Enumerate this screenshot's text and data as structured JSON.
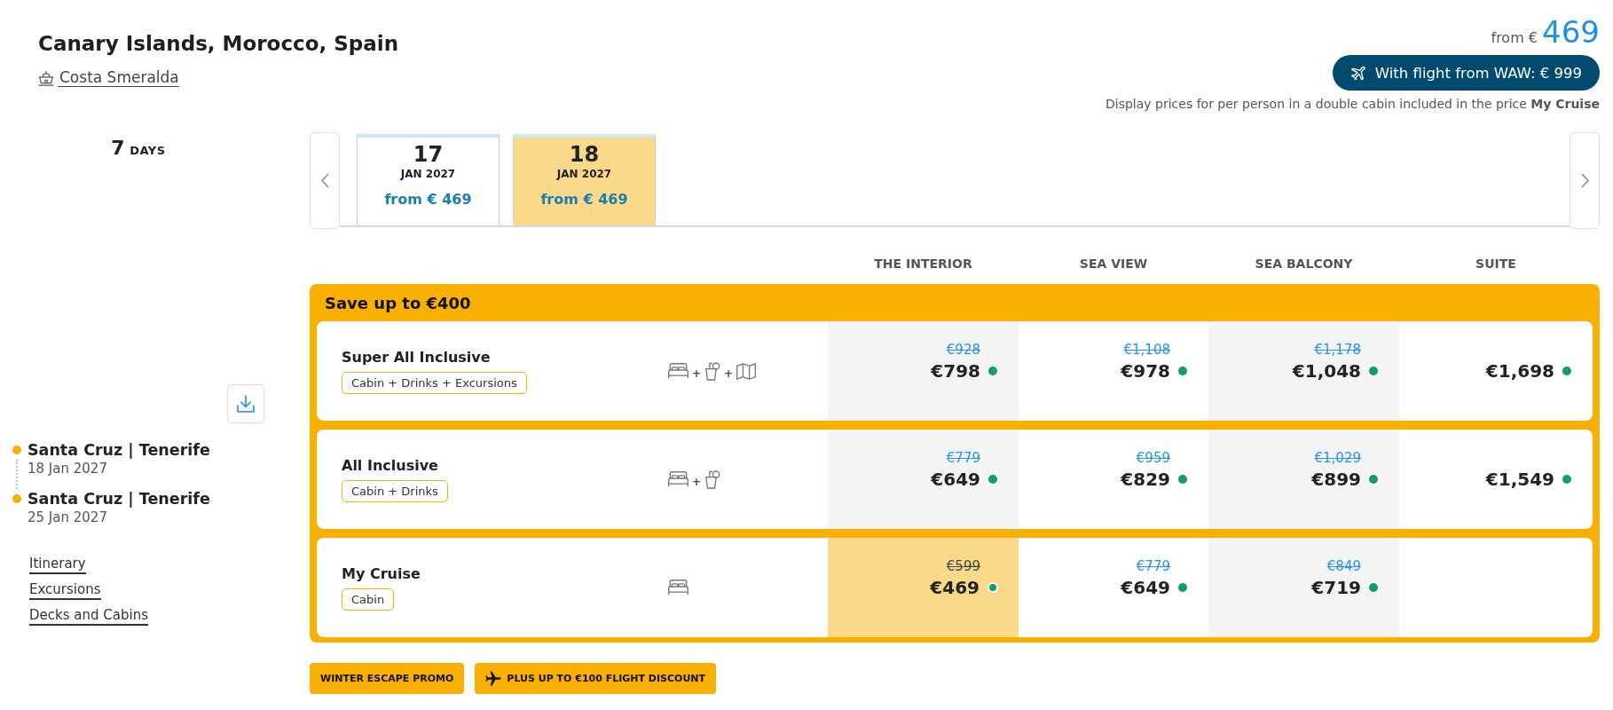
{
  "header": {
    "title": "Canary Islands, Morocco, Spain",
    "ship": "Costa Smeralda"
  },
  "pricing": {
    "from_label": "from €",
    "from_price": "469",
    "flight_button": "With flight from WAW: € 999",
    "note": "Display prices for per person in a double cabin included in the price **My Cruise**"
  },
  "duration": {
    "number": "7",
    "unit": "DAYS"
  },
  "date_tabs": [
    {
      "day": "17",
      "month": "JAN 2027",
      "price": "from € 469",
      "selected": false
    },
    {
      "day": "18",
      "month": "JAN 2027",
      "price": "from € 469",
      "selected": true
    }
  ],
  "route": [
    {
      "port": "Santa Cruz | Tenerife",
      "date": "18 Jan 2027"
    },
    {
      "port": "Santa Cruz | Tenerife",
      "date": "25 Jan 2027"
    }
  ],
  "links": [
    "Itinerary",
    "Excursions",
    "Decks and Cabins"
  ],
  "cabin_columns": [
    "THE INTERIOR",
    "SEA VIEW",
    "SEA BALCONY",
    "SUITE"
  ],
  "fare_group": {
    "banner": "Save up to €400",
    "fares": [
      {
        "name": "Super All Inclusive",
        "includes": "Cabin + Drinks + Excursions",
        "amenities": [
          {
            "kind": "cabin"
          },
          {
            "kind": "drinks",
            "joiner": "+"
          },
          {
            "kind": "excursions",
            "joiner": "+"
          }
        ],
        "prices": [
          {
            "was": "€928",
            "now": "€798",
            "selected": false
          },
          {
            "was": "€1,108",
            "now": "€978",
            "selected": false
          },
          {
            "was": "€1,178",
            "now": "€1,048",
            "selected": false
          },
          {
            "now": "€1,698",
            "selected": false
          }
        ]
      },
      {
        "name": "All Inclusive",
        "includes": "Cabin + Drinks",
        "amenities": [
          {
            "kind": "cabin"
          },
          {
            "kind": "drinks",
            "joiner": "+"
          }
        ],
        "prices": [
          {
            "was": "€779",
            "now": "€649",
            "selected": false
          },
          {
            "was": "€959",
            "now": "€829",
            "selected": false
          },
          {
            "was": "€1,029",
            "now": "€899",
            "selected": false
          },
          {
            "now": "€1,549",
            "selected": false
          }
        ]
      },
      {
        "name": "My Cruise",
        "includes": "Cabin",
        "amenities": [
          {
            "kind": "cabin"
          }
        ],
        "prices": [
          {
            "was": "€599",
            "now": "€469",
            "selected": true
          },
          {
            "was": "€779",
            "now": "€649",
            "selected": false
          },
          {
            "was": "€849",
            "now": "€719",
            "selected": false
          }
        ]
      }
    ]
  },
  "promos": [
    {
      "label": "WINTER ESCAPE PROMO",
      "kind": "plain"
    },
    {
      "label": "PLUS UP TO €100 FLIGHT DISCOUNT",
      "kind": "flight"
    }
  ]
}
